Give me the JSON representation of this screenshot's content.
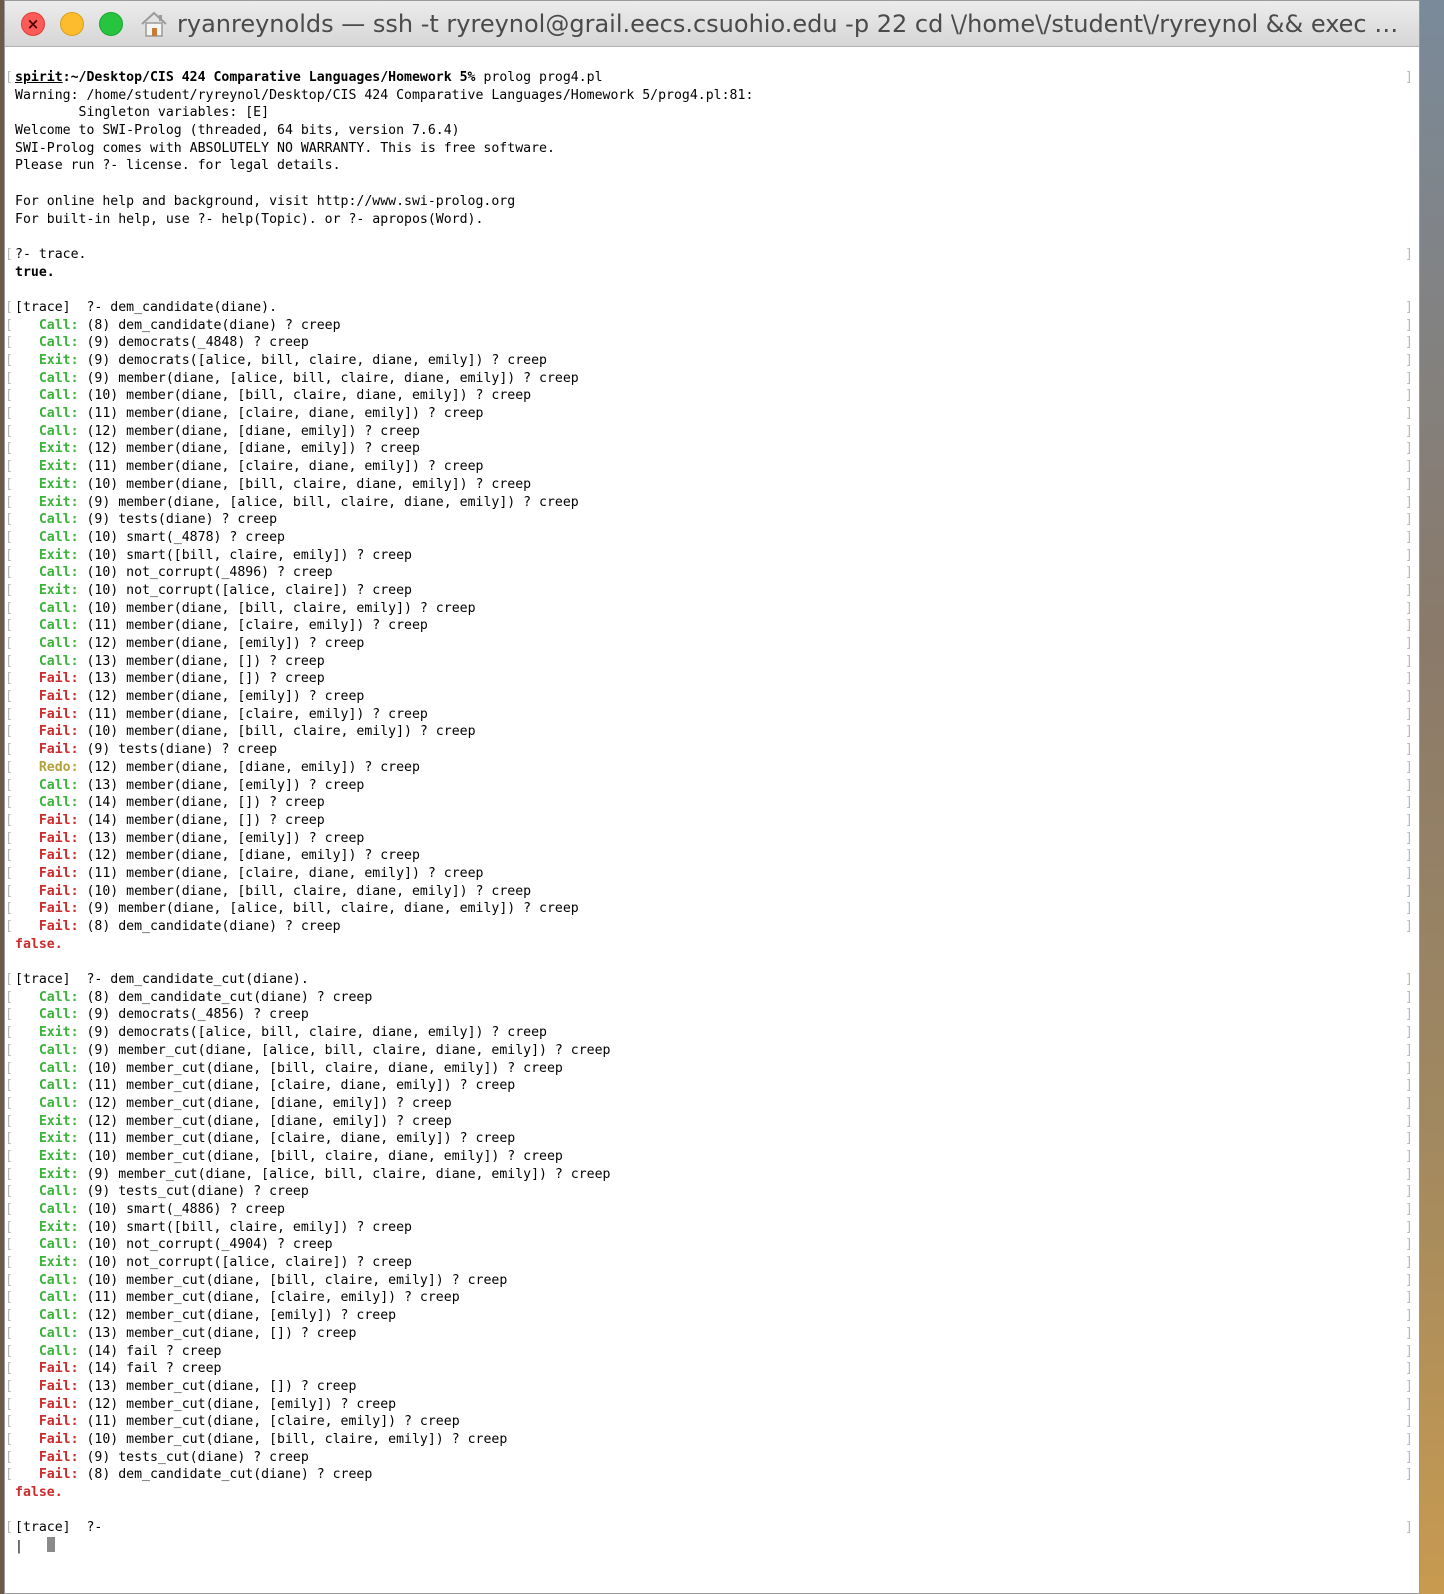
{
  "window": {
    "title": "ryanreynolds — ssh -t ryreynol@grail.eecs.csuohio.edu -p 22 cd \\/home\\/student\\/ryreynol && exec $SH…",
    "colors": {
      "call": "#3bb43b",
      "exit": "#3bb43b",
      "fail": "#cc2b2b",
      "redo": "#b3a13a"
    }
  },
  "terminal": {
    "lines": [
      {
        "type": "prompt",
        "host": "spirit",
        "rest": ":~/Desktop/CIS 424 Comparative Languages/Homework 5% ",
        "cmd": "prolog prog4.pl",
        "bl": true,
        "br": true
      },
      {
        "type": "text",
        "text": "Warning: /home/student/ryreynol/Desktop/CIS 424 Comparative Languages/Homework 5/prog4.pl:81:"
      },
      {
        "type": "text",
        "text": "        Singleton variables: [E]"
      },
      {
        "type": "text",
        "text": "Welcome to SWI-Prolog (threaded, 64 bits, version 7.6.4)"
      },
      {
        "type": "text",
        "text": "SWI-Prolog comes with ABSOLUTELY NO WARRANTY. This is free software."
      },
      {
        "type": "text",
        "text": "Please run ?- license. for legal details."
      },
      {
        "type": "blank"
      },
      {
        "type": "text",
        "text": "For online help and background, visit http://www.swi-prolog.org"
      },
      {
        "type": "text",
        "text": "For built-in help, use ?- help(Topic). or ?- apropos(Word)."
      },
      {
        "type": "blank"
      },
      {
        "type": "text",
        "text": "?- trace.",
        "bl": true,
        "br": true
      },
      {
        "type": "bold",
        "text": "true."
      },
      {
        "type": "blank"
      },
      {
        "type": "text",
        "text": "[trace]  ?- dem_candidate(diane).",
        "bl": true,
        "br": true
      },
      {
        "type": "port",
        "port": "Call:",
        "goal": " (8) dem_candidate(diane) ? creep"
      },
      {
        "type": "port",
        "port": "Call:",
        "goal": " (9) democrats(_4848) ? creep"
      },
      {
        "type": "port",
        "port": "Exit:",
        "goal": " (9) democrats([alice, bill, claire, diane, emily]) ? creep"
      },
      {
        "type": "port",
        "port": "Call:",
        "goal": " (9) member(diane, [alice, bill, claire, diane, emily]) ? creep"
      },
      {
        "type": "port",
        "port": "Call:",
        "goal": " (10) member(diane, [bill, claire, diane, emily]) ? creep"
      },
      {
        "type": "port",
        "port": "Call:",
        "goal": " (11) member(diane, [claire, diane, emily]) ? creep"
      },
      {
        "type": "port",
        "port": "Call:",
        "goal": " (12) member(diane, [diane, emily]) ? creep"
      },
      {
        "type": "port",
        "port": "Exit:",
        "goal": " (12) member(diane, [diane, emily]) ? creep"
      },
      {
        "type": "port",
        "port": "Exit:",
        "goal": " (11) member(diane, [claire, diane, emily]) ? creep"
      },
      {
        "type": "port",
        "port": "Exit:",
        "goal": " (10) member(diane, [bill, claire, diane, emily]) ? creep"
      },
      {
        "type": "port",
        "port": "Exit:",
        "goal": " (9) member(diane, [alice, bill, claire, diane, emily]) ? creep"
      },
      {
        "type": "port",
        "port": "Call:",
        "goal": " (9) tests(diane) ? creep"
      },
      {
        "type": "port",
        "port": "Call:",
        "goal": " (10) smart(_4878) ? creep"
      },
      {
        "type": "port",
        "port": "Exit:",
        "goal": " (10) smart([bill, claire, emily]) ? creep"
      },
      {
        "type": "port",
        "port": "Call:",
        "goal": " (10) not_corrupt(_4896) ? creep"
      },
      {
        "type": "port",
        "port": "Exit:",
        "goal": " (10) not_corrupt([alice, claire]) ? creep"
      },
      {
        "type": "port",
        "port": "Call:",
        "goal": " (10) member(diane, [bill, claire, emily]) ? creep"
      },
      {
        "type": "port",
        "port": "Call:",
        "goal": " (11) member(diane, [claire, emily]) ? creep"
      },
      {
        "type": "port",
        "port": "Call:",
        "goal": " (12) member(diane, [emily]) ? creep"
      },
      {
        "type": "port",
        "port": "Call:",
        "goal": " (13) member(diane, []) ? creep"
      },
      {
        "type": "port",
        "port": "Fail:",
        "goal": " (13) member(diane, []) ? creep"
      },
      {
        "type": "port",
        "port": "Fail:",
        "goal": " (12) member(diane, [emily]) ? creep"
      },
      {
        "type": "port",
        "port": "Fail:",
        "goal": " (11) member(diane, [claire, emily]) ? creep"
      },
      {
        "type": "port",
        "port": "Fail:",
        "goal": " (10) member(diane, [bill, claire, emily]) ? creep"
      },
      {
        "type": "port",
        "port": "Fail:",
        "goal": " (9) tests(diane) ? creep"
      },
      {
        "type": "port",
        "port": "Redo:",
        "goal": " (12) member(diane, [diane, emily]) ? creep"
      },
      {
        "type": "port",
        "port": "Call:",
        "goal": " (13) member(diane, [emily]) ? creep"
      },
      {
        "type": "port",
        "port": "Call:",
        "goal": " (14) member(diane, []) ? creep"
      },
      {
        "type": "port",
        "port": "Fail:",
        "goal": " (14) member(diane, []) ? creep"
      },
      {
        "type": "port",
        "port": "Fail:",
        "goal": " (13) member(diane, [emily]) ? creep"
      },
      {
        "type": "port",
        "port": "Fail:",
        "goal": " (12) member(diane, [diane, emily]) ? creep"
      },
      {
        "type": "port",
        "port": "Fail:",
        "goal": " (11) member(diane, [claire, diane, emily]) ? creep"
      },
      {
        "type": "port",
        "port": "Fail:",
        "goal": " (10) member(diane, [bill, claire, diane, emily]) ? creep"
      },
      {
        "type": "port",
        "port": "Fail:",
        "goal": " (9) member(diane, [alice, bill, claire, diane, emily]) ? creep"
      },
      {
        "type": "port",
        "port": "Fail:",
        "goal": " (8) dem_candidate(diane) ? creep"
      },
      {
        "type": "false",
        "text": "false."
      },
      {
        "type": "blank"
      },
      {
        "type": "text",
        "text": "[trace]  ?- dem_candidate_cut(diane).",
        "bl": true,
        "br": true
      },
      {
        "type": "port",
        "port": "Call:",
        "goal": " (8) dem_candidate_cut(diane) ? creep"
      },
      {
        "type": "port",
        "port": "Call:",
        "goal": " (9) democrats(_4856) ? creep"
      },
      {
        "type": "port",
        "port": "Exit:",
        "goal": " (9) democrats([alice, bill, claire, diane, emily]) ? creep"
      },
      {
        "type": "port",
        "port": "Call:",
        "goal": " (9) member_cut(diane, [alice, bill, claire, diane, emily]) ? creep"
      },
      {
        "type": "port",
        "port": "Call:",
        "goal": " (10) member_cut(diane, [bill, claire, diane, emily]) ? creep"
      },
      {
        "type": "port",
        "port": "Call:",
        "goal": " (11) member_cut(diane, [claire, diane, emily]) ? creep"
      },
      {
        "type": "port",
        "port": "Call:",
        "goal": " (12) member_cut(diane, [diane, emily]) ? creep"
      },
      {
        "type": "port",
        "port": "Exit:",
        "goal": " (12) member_cut(diane, [diane, emily]) ? creep"
      },
      {
        "type": "port",
        "port": "Exit:",
        "goal": " (11) member_cut(diane, [claire, diane, emily]) ? creep"
      },
      {
        "type": "port",
        "port": "Exit:",
        "goal": " (10) member_cut(diane, [bill, claire, diane, emily]) ? creep"
      },
      {
        "type": "port",
        "port": "Exit:",
        "goal": " (9) member_cut(diane, [alice, bill, claire, diane, emily]) ? creep"
      },
      {
        "type": "port",
        "port": "Call:",
        "goal": " (9) tests_cut(diane) ? creep"
      },
      {
        "type": "port",
        "port": "Call:",
        "goal": " (10) smart(_4886) ? creep"
      },
      {
        "type": "port",
        "port": "Exit:",
        "goal": " (10) smart([bill, claire, emily]) ? creep"
      },
      {
        "type": "port",
        "port": "Call:",
        "goal": " (10) not_corrupt(_4904) ? creep"
      },
      {
        "type": "port",
        "port": "Exit:",
        "goal": " (10) not_corrupt([alice, claire]) ? creep"
      },
      {
        "type": "port",
        "port": "Call:",
        "goal": " (10) member_cut(diane, [bill, claire, emily]) ? creep"
      },
      {
        "type": "port",
        "port": "Call:",
        "goal": " (11) member_cut(diane, [claire, emily]) ? creep"
      },
      {
        "type": "port",
        "port": "Call:",
        "goal": " (12) member_cut(diane, [emily]) ? creep"
      },
      {
        "type": "port",
        "port": "Call:",
        "goal": " (13) member_cut(diane, []) ? creep"
      },
      {
        "type": "port",
        "port": "Call:",
        "goal": " (14) fail ? creep"
      },
      {
        "type": "port",
        "port": "Fail:",
        "goal": " (14) fail ? creep"
      },
      {
        "type": "port",
        "port": "Fail:",
        "goal": " (13) member_cut(diane, []) ? creep"
      },
      {
        "type": "port",
        "port": "Fail:",
        "goal": " (12) member_cut(diane, [emily]) ? creep"
      },
      {
        "type": "port",
        "port": "Fail:",
        "goal": " (11) member_cut(diane, [claire, emily]) ? creep"
      },
      {
        "type": "port",
        "port": "Fail:",
        "goal": " (10) member_cut(diane, [bill, claire, emily]) ? creep"
      },
      {
        "type": "port",
        "port": "Fail:",
        "goal": " (9) tests_cut(diane) ? creep"
      },
      {
        "type": "port",
        "port": "Fail:",
        "goal": " (8) dem_candidate_cut(diane) ? creep"
      },
      {
        "type": "false",
        "text": "false."
      },
      {
        "type": "blank"
      },
      {
        "type": "text",
        "text": "[trace]  ?-",
        "bl": true,
        "br": true
      },
      {
        "type": "cursor",
        "text": "|   "
      }
    ]
  }
}
